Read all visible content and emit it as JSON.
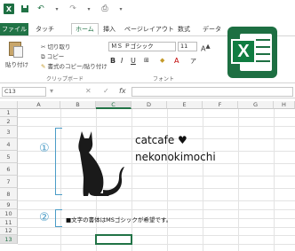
{
  "ribbon_tabs": {
    "file": "ファイル",
    "home": "ホーム",
    "touch": "タッチ",
    "insert": "挿入",
    "page_layout": "ページレイアウト",
    "formulas": "数式",
    "data": "データ"
  },
  "clipboard": {
    "paste": "貼り付け",
    "cut": "切り取り",
    "copy": "コピー",
    "format_painter": "書式のコピー/貼り付け",
    "group_label": "クリップボード"
  },
  "font": {
    "name": "ＭＳ Ｐゴシック",
    "size": "11",
    "group_label": "フォント"
  },
  "formula_bar": {
    "name_box": "C13",
    "fx": "fx"
  },
  "grid": {
    "columns": [
      "A",
      "B",
      "C",
      "D",
      "E",
      "F",
      "G",
      "H"
    ],
    "rows": [
      "1",
      "2",
      "3",
      "4",
      "5",
      "6",
      "7",
      "8",
      "9",
      "10",
      "11",
      "12",
      "13"
    ]
  },
  "content": {
    "marker1": "①",
    "marker2": "②",
    "title_line1": "catcafe ♥",
    "title_line2": "nekonokimochi",
    "note": "■文字の書体はMSゴシックが希望です。"
  },
  "colors": {
    "excel_green": "#217346",
    "marker_blue": "#4a9cc7"
  }
}
